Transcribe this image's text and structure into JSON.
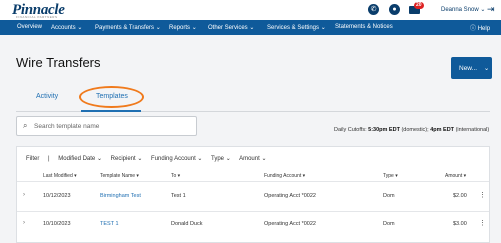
{
  "brand": {
    "name": "Pinnacle",
    "tagline": "FINANCIAL PARTNERS"
  },
  "header": {
    "notification_count": "20",
    "user_name": "Deanna Snow"
  },
  "nav": {
    "items": [
      "Overview",
      "Accounts",
      "Payments & Transfers",
      "Reports",
      "Other Services",
      "Services & Settings",
      "Statements & Notices"
    ],
    "help": "Help"
  },
  "page": {
    "title": "Wire Transfers",
    "new_button": "New..."
  },
  "tabs": [
    {
      "label": "Activity"
    },
    {
      "label": "Templates",
      "active": true
    }
  ],
  "search": {
    "placeholder": "Search template name"
  },
  "cutoffs": {
    "label": "Daily Cutoffs:",
    "domestic_time": "5:30pm EDT",
    "domestic_label": "(domestic);",
    "international_time": "4pm EDT",
    "international_label": "(international)"
  },
  "filters": {
    "label": "Filter",
    "items": [
      "Modified Date",
      "Recipient",
      "Funding Account",
      "Type",
      "Amount"
    ]
  },
  "table": {
    "columns": [
      "Last Modified",
      "Template Name",
      "To",
      "Funding Account",
      "Type",
      "Amount"
    ],
    "rows": [
      {
        "last_modified": "10/12/2023",
        "template_name": "Birmingham Test",
        "to": "Test 1",
        "funding_account": "Operating Acct *0022",
        "type": "Dom",
        "amount": "$2.00"
      },
      {
        "last_modified": "10/10/2023",
        "template_name": "TEST 1",
        "to": "Donald Duck",
        "funding_account": "Operating Acct *0022",
        "type": "Dom",
        "amount": "$3.00"
      }
    ]
  },
  "colors": {
    "nav": "#0f5a9a",
    "link": "#1f6fb2",
    "highlight": "#f07a1c",
    "badge": "#d22222"
  }
}
